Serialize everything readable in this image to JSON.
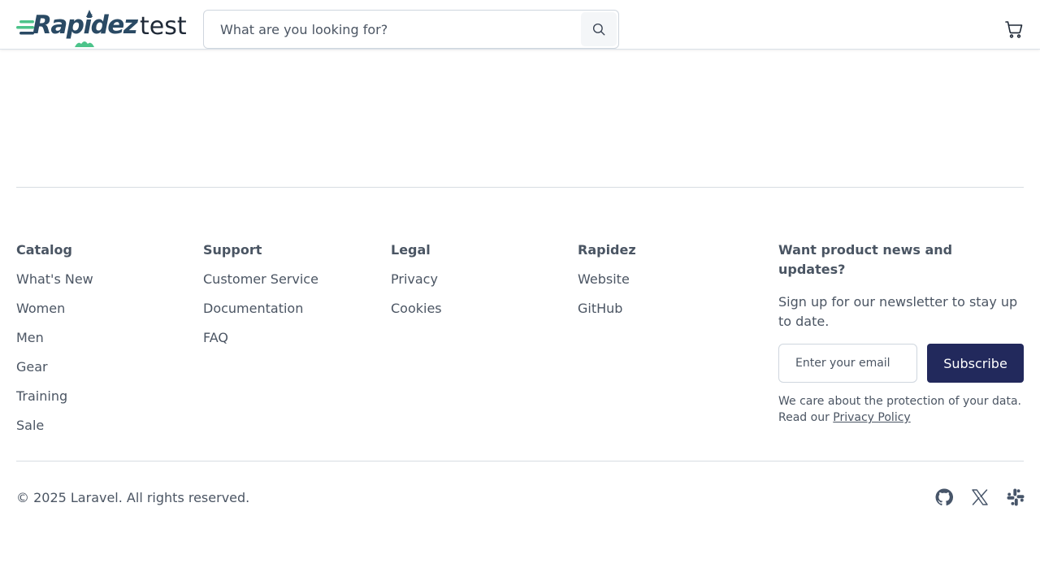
{
  "header": {
    "logo_word": "Rapidez",
    "logo_suffix": "test",
    "search_placeholder": "What are you looking for?",
    "search_icon": "search-icon",
    "cart_icon": "shopping-cart-icon"
  },
  "footer": {
    "columns": [
      {
        "title": "Catalog",
        "links": [
          "What's New",
          "Women",
          "Men",
          "Gear",
          "Training",
          "Sale"
        ]
      },
      {
        "title": "Support",
        "links": [
          "Customer Service",
          "Documentation",
          "FAQ"
        ]
      },
      {
        "title": "Legal",
        "links": [
          "Privacy",
          "Cookies"
        ]
      },
      {
        "title": "Rapidez",
        "links": [
          "Website",
          "GitHub"
        ]
      }
    ],
    "newsletter": {
      "title": "Want product news and updates?",
      "description": "Sign up for our newsletter to stay up to date.",
      "email_placeholder": "Enter your email",
      "subscribe_label": "Subscribe",
      "note_prefix": "We care about the protection of your data. Read our",
      "privacy_link": "Privacy Policy"
    },
    "copyright": "© 2025 Laravel. All rights reserved.",
    "social": [
      "github-icon",
      "x-icon",
      "slack-icon"
    ]
  },
  "colors": {
    "brand_dark": "#2a4a64",
    "brand_green": "#4cc38a",
    "button": "#22295c",
    "text": "#4b5563"
  }
}
